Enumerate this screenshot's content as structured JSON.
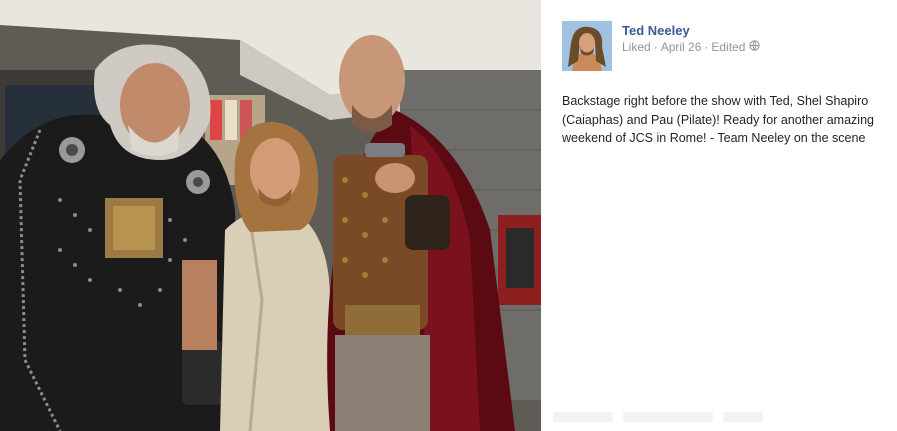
{
  "post": {
    "author_name": "Ted Neeley",
    "status": "Liked",
    "date": "April 26",
    "edited": "Edited",
    "separator": "·",
    "caption": "Backstage right before the show with Ted, Shel Shapiro (Caiaphas) and Pau (Pilate)! Ready for another amazing weekend of JCS in Rome! - Team Neeley on the scene",
    "privacy_icon": "globe-icon"
  },
  "photo": {
    "description_icon": "photo"
  },
  "colors": {
    "author_link": "#3b5998",
    "meta_text": "#90949c",
    "body_text": "#1d2129"
  }
}
